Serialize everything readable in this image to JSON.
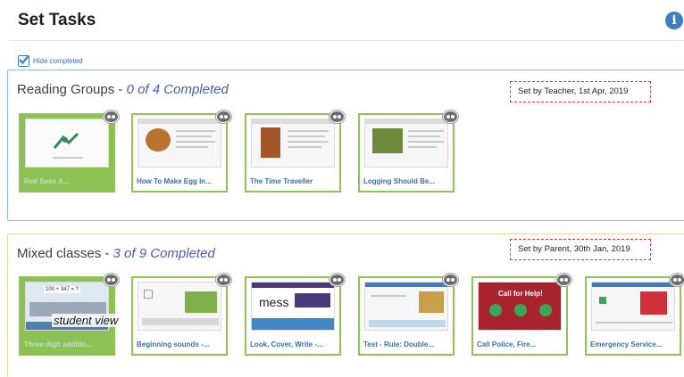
{
  "header": {
    "title": "Set Tasks",
    "info_icon": "info-icon"
  },
  "filter": {
    "hide_completed_label": "Hide completed",
    "checked": true
  },
  "groups": [
    {
      "name": "Reading Groups",
      "separator": " - ",
      "count_text": "0 of 4 Completed",
      "set_by": "Set by Teacher, 1st Apr, 2019",
      "tasks": [
        {
          "name": "Red Sees A...",
          "completed": true
        },
        {
          "name": "How To Make Egg In...",
          "completed": false
        },
        {
          "name": "The Time Traveller",
          "completed": false
        },
        {
          "name": "Logging Should Be...",
          "completed": false
        }
      ]
    },
    {
      "name": "Mixed classes",
      "separator": " - ",
      "count_text": "3 of 9 Completed",
      "set_by": "Set by Parent, 30th Jan, 2019",
      "tasks": [
        {
          "name": "Three digit additio...",
          "completed": true
        },
        {
          "name": "Beginning sounds -...",
          "completed": false
        },
        {
          "name": "Look, Cover, Write -...",
          "completed": false
        },
        {
          "name": "Test - Rule: Double...",
          "completed": false
        },
        {
          "name": "Call Police, Fire...",
          "completed": false
        },
        {
          "name": "Emergency Service...",
          "completed": false
        }
      ]
    }
  ],
  "overlay": {
    "student_view_label": "student view"
  },
  "thumbs": {
    "mess_word": "mess",
    "call_for_help": "Call for Help!",
    "sum": "100 + 347 = ?"
  },
  "colors": {
    "accent": "#3a7fc4",
    "completed_tile": "#8dc153",
    "tile_border": "#8ec456",
    "set_by_border": "#d0384a"
  }
}
